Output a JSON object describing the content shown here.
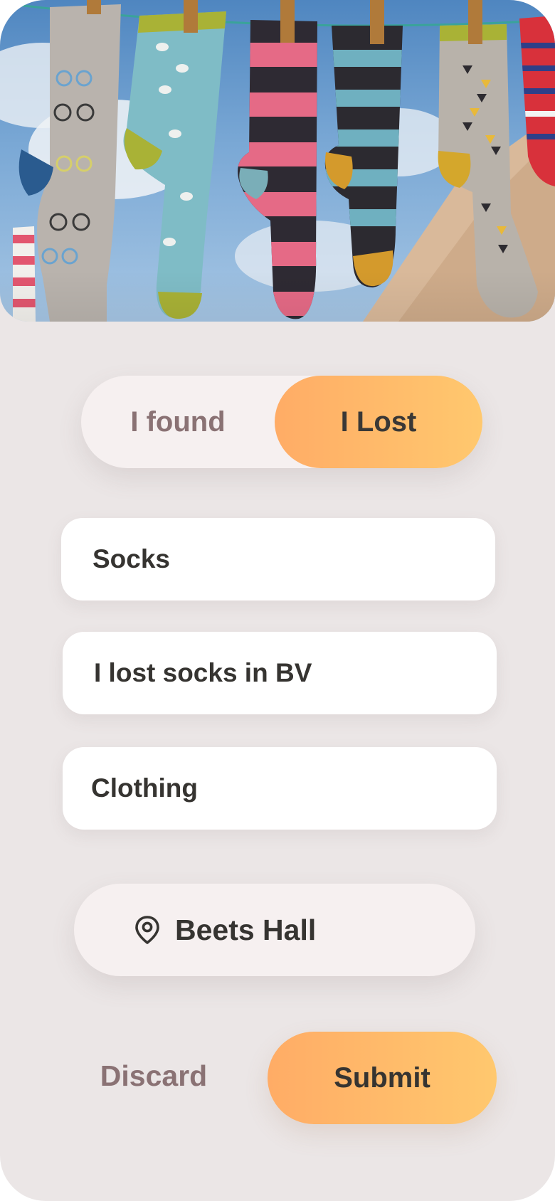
{
  "hero": {
    "image": "socks-on-clothesline-photo"
  },
  "report_type": {
    "options": [
      "I found",
      "I Lost"
    ],
    "selected": "I Lost"
  },
  "form": {
    "item_name": "Socks",
    "description": "I lost socks in BV",
    "category": "Clothing"
  },
  "location": {
    "icon": "map-pin-icon",
    "label": "Beets Hall"
  },
  "actions": {
    "discard_label": "Discard",
    "submit_label": "Submit"
  },
  "colors": {
    "background": "#ebe6e6",
    "accent_start": "#ffac66",
    "accent_end": "#ffc86e",
    "muted_text": "#8a7274",
    "text": "#363431"
  }
}
